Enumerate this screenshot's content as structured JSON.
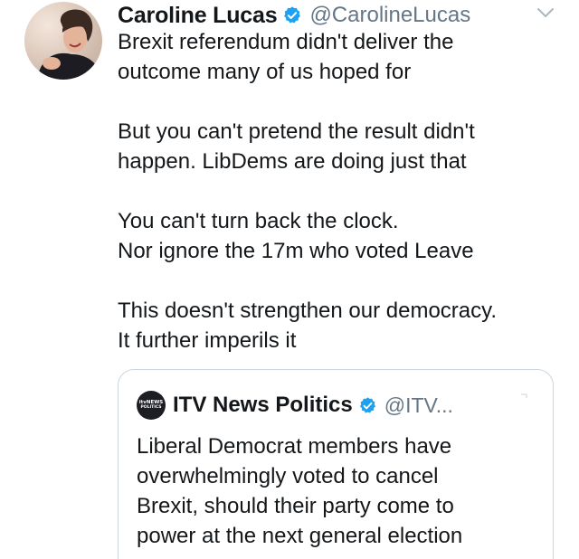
{
  "tweet": {
    "display_name": "Caroline Lucas",
    "handle": "@CarolineLucas",
    "verified": true,
    "avatar_icon": "profile-photo",
    "menu_icon": "chevron-down-icon",
    "paragraphs": [
      [
        "Brexit referendum didn't deliver the",
        "outcome many of us hoped for"
      ],
      [
        "But you can't pretend the result didn't",
        "happen. LibDems are doing just that"
      ],
      [
        "You can't turn back the clock.",
        "Nor ignore the 17m who voted Leave"
      ],
      [
        "This doesn't strengthen our democracy.",
        "It further imperils it"
      ]
    ]
  },
  "quoted_tweet": {
    "display_name": "ITV News Politics",
    "handle": "@ITV...",
    "verified": true,
    "avatar_text": {
      "brand": "itvNEWS",
      "sub": "POLITICS"
    },
    "lines": [
      "Liberal Democrat members have",
      "overwhelmingly voted to cancel",
      "Brexit, should their party come to",
      "power at the next general election"
    ]
  },
  "colors": {
    "verified_blue": "#1da1f2",
    "secondary_text": "#657786",
    "border": "#ccd6dd"
  }
}
